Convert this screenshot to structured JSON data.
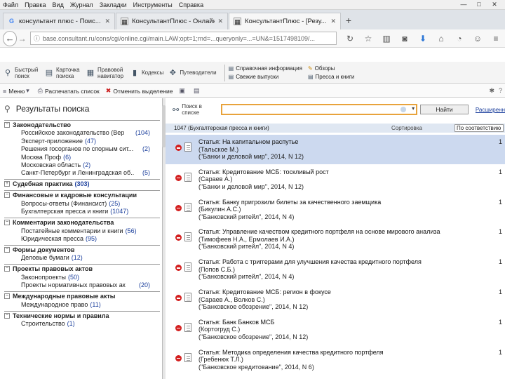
{
  "menu": [
    "Файл",
    "Правка",
    "Вид",
    "Журнал",
    "Закладки",
    "Инструменты",
    "Справка"
  ],
  "window_controls": [
    "—",
    "□",
    "✕"
  ],
  "tabs": [
    {
      "title": "консультант плюс - Поис...",
      "icon": "google-icon"
    },
    {
      "title": "КонсультантПлюс - Онлайн...",
      "icon": "consultant-icon"
    },
    {
      "title": "КонсультантПлюс - [Резу...",
      "icon": "consultant-icon"
    }
  ],
  "url": "base.consultant.ru/cons/cgi/online.cgi/main.LAW;opt=1;rnd=...queryonly=...=UN&=1517498109/...",
  "app_toolbar": {
    "buttons": [
      "Быстрый поиск",
      "Карточка поиска",
      "Правовой навигатор",
      "Кодексы",
      "Путеводители"
    ],
    "stack1": [
      "Справочная информация",
      "Свежие выпуски"
    ],
    "stack2": [
      "Обзоры",
      "Пресса и книги"
    ]
  },
  "subtoolbar": {
    "menu": "Меню",
    "print_list": "Распечатать список",
    "clear_selection": "Отменить выделение"
  },
  "left": {
    "title": "Результаты поиска",
    "items": [
      {
        "kind": "cat",
        "label": "Законодательство",
        "count": "",
        "toggle": "−"
      },
      {
        "kind": "sub",
        "label": "Российское законодательство (Вер",
        "count": "(104)"
      },
      {
        "kind": "sub",
        "label": "Эксперт-приложение",
        "count": "(47)",
        "inline": true
      },
      {
        "kind": "sub",
        "label": "Решения госорганов по спорным сит...",
        "count": "(2)"
      },
      {
        "kind": "sub",
        "label": "Москва Проф",
        "count": "(6)",
        "inline": true
      },
      {
        "kind": "sub",
        "label": "Московская область",
        "count": "(2)",
        "inline": true
      },
      {
        "kind": "sub",
        "label": "Санкт-Петербург и Ленинградская об...",
        "count": "(5)"
      },
      {
        "kind": "cat",
        "label": "Судебная практика",
        "count": "(303)",
        "toggle": "+",
        "inline": true
      },
      {
        "kind": "cat",
        "label": "Финансовые и кадровые консультации",
        "count": "",
        "toggle": "−"
      },
      {
        "kind": "sub",
        "label": "Вопросы-ответы (Финансист)",
        "count": "(25)",
        "inline": true
      },
      {
        "kind": "sub",
        "label": "Бухгалтерская пресса и книги",
        "count": "(1047)",
        "inline": true
      },
      {
        "kind": "cat",
        "label": "Комментарии законодательства",
        "count": "",
        "toggle": "−"
      },
      {
        "kind": "sub",
        "label": "Постатейные комментарии и книги",
        "count": "(56)",
        "inline": true
      },
      {
        "kind": "sub",
        "label": "Юридическая пресса",
        "count": "(95)",
        "inline": true
      },
      {
        "kind": "cat",
        "label": "Формы документов",
        "count": "",
        "toggle": "−"
      },
      {
        "kind": "sub",
        "label": "Деловые бумаги",
        "count": "(12)",
        "inline": true
      },
      {
        "kind": "cat",
        "label": "Проекты правовых актов",
        "count": "",
        "toggle": "−"
      },
      {
        "kind": "sub",
        "label": "Законопроекты",
        "count": "(50)",
        "inline": true
      },
      {
        "kind": "sub",
        "label": "Проекты нормативных правовых ак",
        "count": "(20)"
      },
      {
        "kind": "cat",
        "label": "Международные правовые акты",
        "count": "",
        "toggle": "−"
      },
      {
        "kind": "sub",
        "label": "Международное право",
        "count": "(11)",
        "inline": true
      },
      {
        "kind": "cat",
        "label": "Технические нормы и правила",
        "count": "",
        "toggle": "−"
      },
      {
        "kind": "sub",
        "label": "Строительство",
        "count": "(1)",
        "inline": true
      }
    ]
  },
  "search": {
    "label": "Поиск в списке",
    "value": "",
    "find_button": "Найти",
    "extended": "Расширенн"
  },
  "list": {
    "header": "1047 (Бухгалтерская пресса и книги)",
    "sort_label": "Сортировка",
    "sort_value": "По соответствию"
  },
  "docs": [
    {
      "l1": "Статья: На капитальном распутье",
      "l2": "(Тальское М.)",
      "l3": "(\"Банки и деловой мир\", 2014, N 12)",
      "n": "1",
      "selected": true
    },
    {
      "l1": "Статья: Кредитование МСБ: тоскливый рост",
      "l2": "(Сараев А.)",
      "l3": "(\"Банки и деловой мир\", 2014, N 12)",
      "n": "1"
    },
    {
      "l1": "Статья: Банку пригрозили билеты за качественного заемщика",
      "l2": "(Бикулин А.С.)",
      "l3": "(\"Банковский ритейл\", 2014, N 4)",
      "n": "1"
    },
    {
      "l1": "Статья: Управление качеством кредитного портфеля на основе мирового анализа",
      "l2": "(Тимофеев Н.А., Ермолаев И.А.)",
      "l3": "(\"Банковский ритейл\", 2014, N 4)",
      "n": "1"
    },
    {
      "l1": "Статья: Работа с триггерами для улучшения качества кредитного портфеля",
      "l2": "(Попов С.Б.)",
      "l3": "(\"Банковский ритейл\", 2014, N 4)",
      "n": "1"
    },
    {
      "l1": "Статья: Кредитование МСБ: регион в фокусе",
      "l2": "(Сараев А., Волков С.)",
      "l3": "(\"Банковское обозрение\", 2014, N 12)",
      "n": "1"
    },
    {
      "l1": "Статья: Банк Банков МСБ",
      "l2": "(Кортогруд С.)",
      "l3": "(\"Банковское обозрение\", 2014, N 12)",
      "n": "1"
    },
    {
      "l1": "Статья: Методика определения качества кредитного портфеля",
      "l2": "(Гребенюк Т.Л.)",
      "l3": "(\"Банковское кредитование\", 2014, N 6)",
      "n": "1"
    }
  ]
}
